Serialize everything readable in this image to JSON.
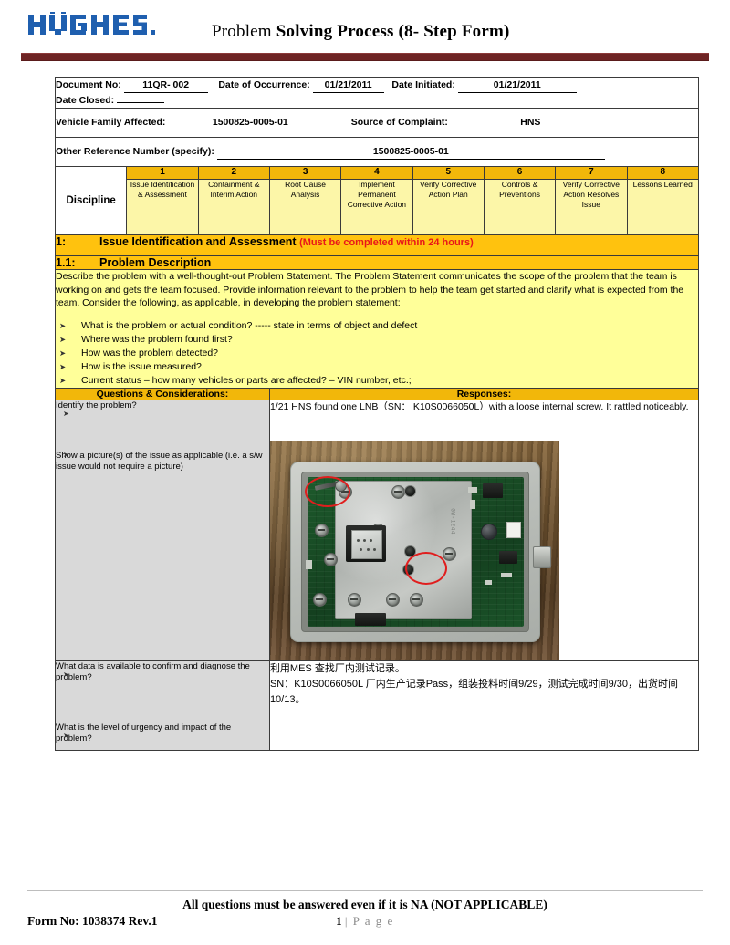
{
  "header": {
    "logo_text": "HUGHES",
    "logo_color": "#1F5FAF",
    "title_light": "Problem ",
    "title_bold": "Solving Process (8- Step Form)",
    "rule_color": "#6E2424"
  },
  "info": {
    "document_no_label": "Document No:",
    "document_no_value": "11QR- 002",
    "date_of_occurrence_label": "Date of Occurrence:",
    "date_of_occurrence_value": "01/21/2011",
    "date_initiated_label": "Date Initiated:",
    "date_initiated_value": "01/21/2011",
    "date_closed_label": "Date Closed:",
    "date_closed_value": "",
    "vehicle_family_label": "Vehicle Family Affected:",
    "vehicle_family_value": "1500825-0005-01",
    "source_of_complaint_label": "Source of Complaint:",
    "source_of_complaint_value": "HNS",
    "other_reference_label": "Other Reference Number (specify):",
    "other_reference_value": "1500825-0005-01"
  },
  "discipline": {
    "row_label": "Discipline",
    "header_bg": "#F2B70A",
    "body_bg": "#FCF6A8",
    "steps": [
      {
        "num": "1",
        "label": "Issue Identification & Assessment"
      },
      {
        "num": "2",
        "label": "Containment & Interim Action"
      },
      {
        "num": "3",
        "label": "Root Cause Analysis"
      },
      {
        "num": "4",
        "label": "Implement Permanent Corrective Action"
      },
      {
        "num": "5",
        "label": "Verify Corrective Action Plan"
      },
      {
        "num": "6",
        "label": "Controls & Preventions"
      },
      {
        "num": "7",
        "label": "Verify Corrective Action Resolves Issue"
      },
      {
        "num": "8",
        "label": "Lessons Learned"
      }
    ]
  },
  "section1": {
    "num": "1:",
    "title": "Issue Identification and Assessment",
    "note": "(Must be completed within 24 hours)",
    "note_color": "#E8161A",
    "bar_bg": "#FFC20E"
  },
  "section11": {
    "num": "1.1:",
    "title": "Problem Description"
  },
  "instructions": {
    "bg": "#FFFF99",
    "paragraph": "Describe the problem with a well-thought-out Problem Statement.   The Problem Statement communicates the scope of the problem that the team is working on and gets the team focused.   Provide information relevant to the problem to help the team get started and clarify what is expected from the team.   Consider the following, as applicable, in developing the problem statement:",
    "bullets": [
      "What is the problem or actual condition?    ----- state in terms of object and defect",
      "Where was the problem found first?",
      "How was the problem detected?",
      "How is the issue measured?",
      "Current status – how many vehicles or parts are affected?   – VIN number, etc.;"
    ]
  },
  "qa": {
    "col_questions": "Questions & Considerations:",
    "col_responses": "Responses:",
    "rows": [
      {
        "question": "Identify the problem?",
        "answer": "1/21 HNS found one LNB（SN： K10S0066050L）with a loose internal screw.   It rattled noticeably."
      },
      {
        "question": "Show a picture(s) of the issue as applicable (i.e. a s/w issue would not require a picture)",
        "answer": ""
      },
      {
        "question": "What data is available to confirm and diagnose the problem?",
        "answer_line1": "利用MES 查找厂内测试记录。",
        "answer_line2": "SN：K10S0066050L 厂内生产记录Pass，组装投料时间9/29，测试完成时间9/30，出货时间10/13。"
      },
      {
        "question": "What is the level of urgency and impact of the problem?",
        "answer": ""
      }
    ]
  },
  "photo": {
    "caption": "opened LNB housing showing PCB, metal shield, loose screw and empty screw hole circled in red",
    "annotation_color": "#E01E1E",
    "shield_mark": "GW-1244"
  },
  "footer": {
    "note": "All questions must be answered even if it is NA (NOT APPLICABLE)",
    "form_no": "Form No: 1038374 Rev.1",
    "page_num": "1",
    "page_word": "| P a g e"
  }
}
